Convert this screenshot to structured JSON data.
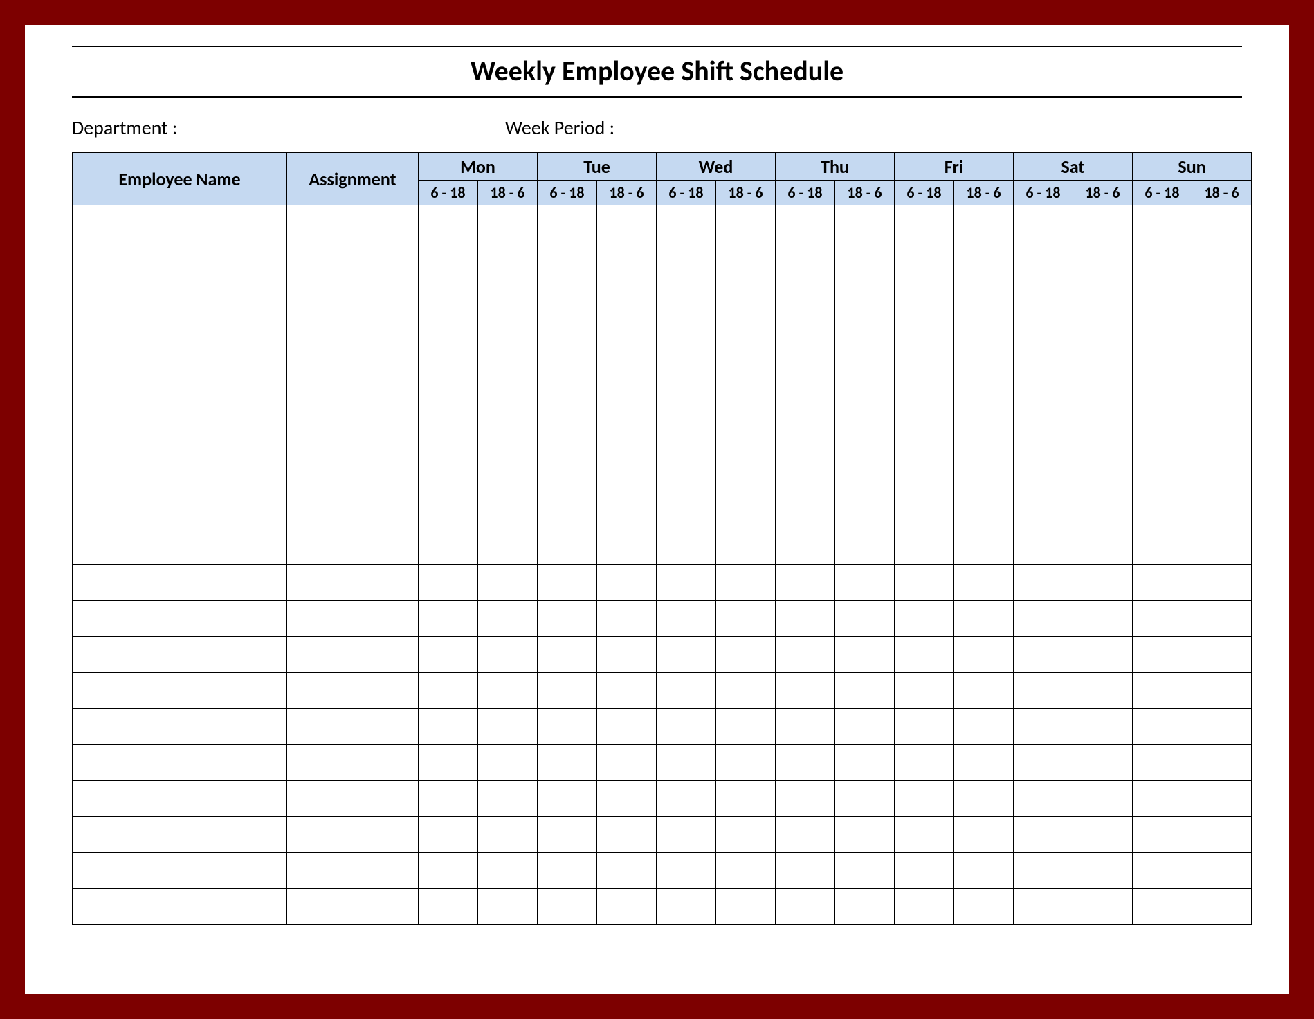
{
  "title": "Weekly Employee Shift Schedule",
  "meta": {
    "department_label": "Department :",
    "department_value": "",
    "week_period_label": "Week  Period :",
    "week_period_value": ""
  },
  "columns": {
    "employee_name": "Employee Name",
    "assignment": "Assignment",
    "days": [
      "Mon",
      "Tue",
      "Wed",
      "Thu",
      "Fri",
      "Sat",
      "Sun"
    ],
    "shifts": [
      "6 - 18",
      "18 - 6"
    ]
  },
  "row_count": 20
}
